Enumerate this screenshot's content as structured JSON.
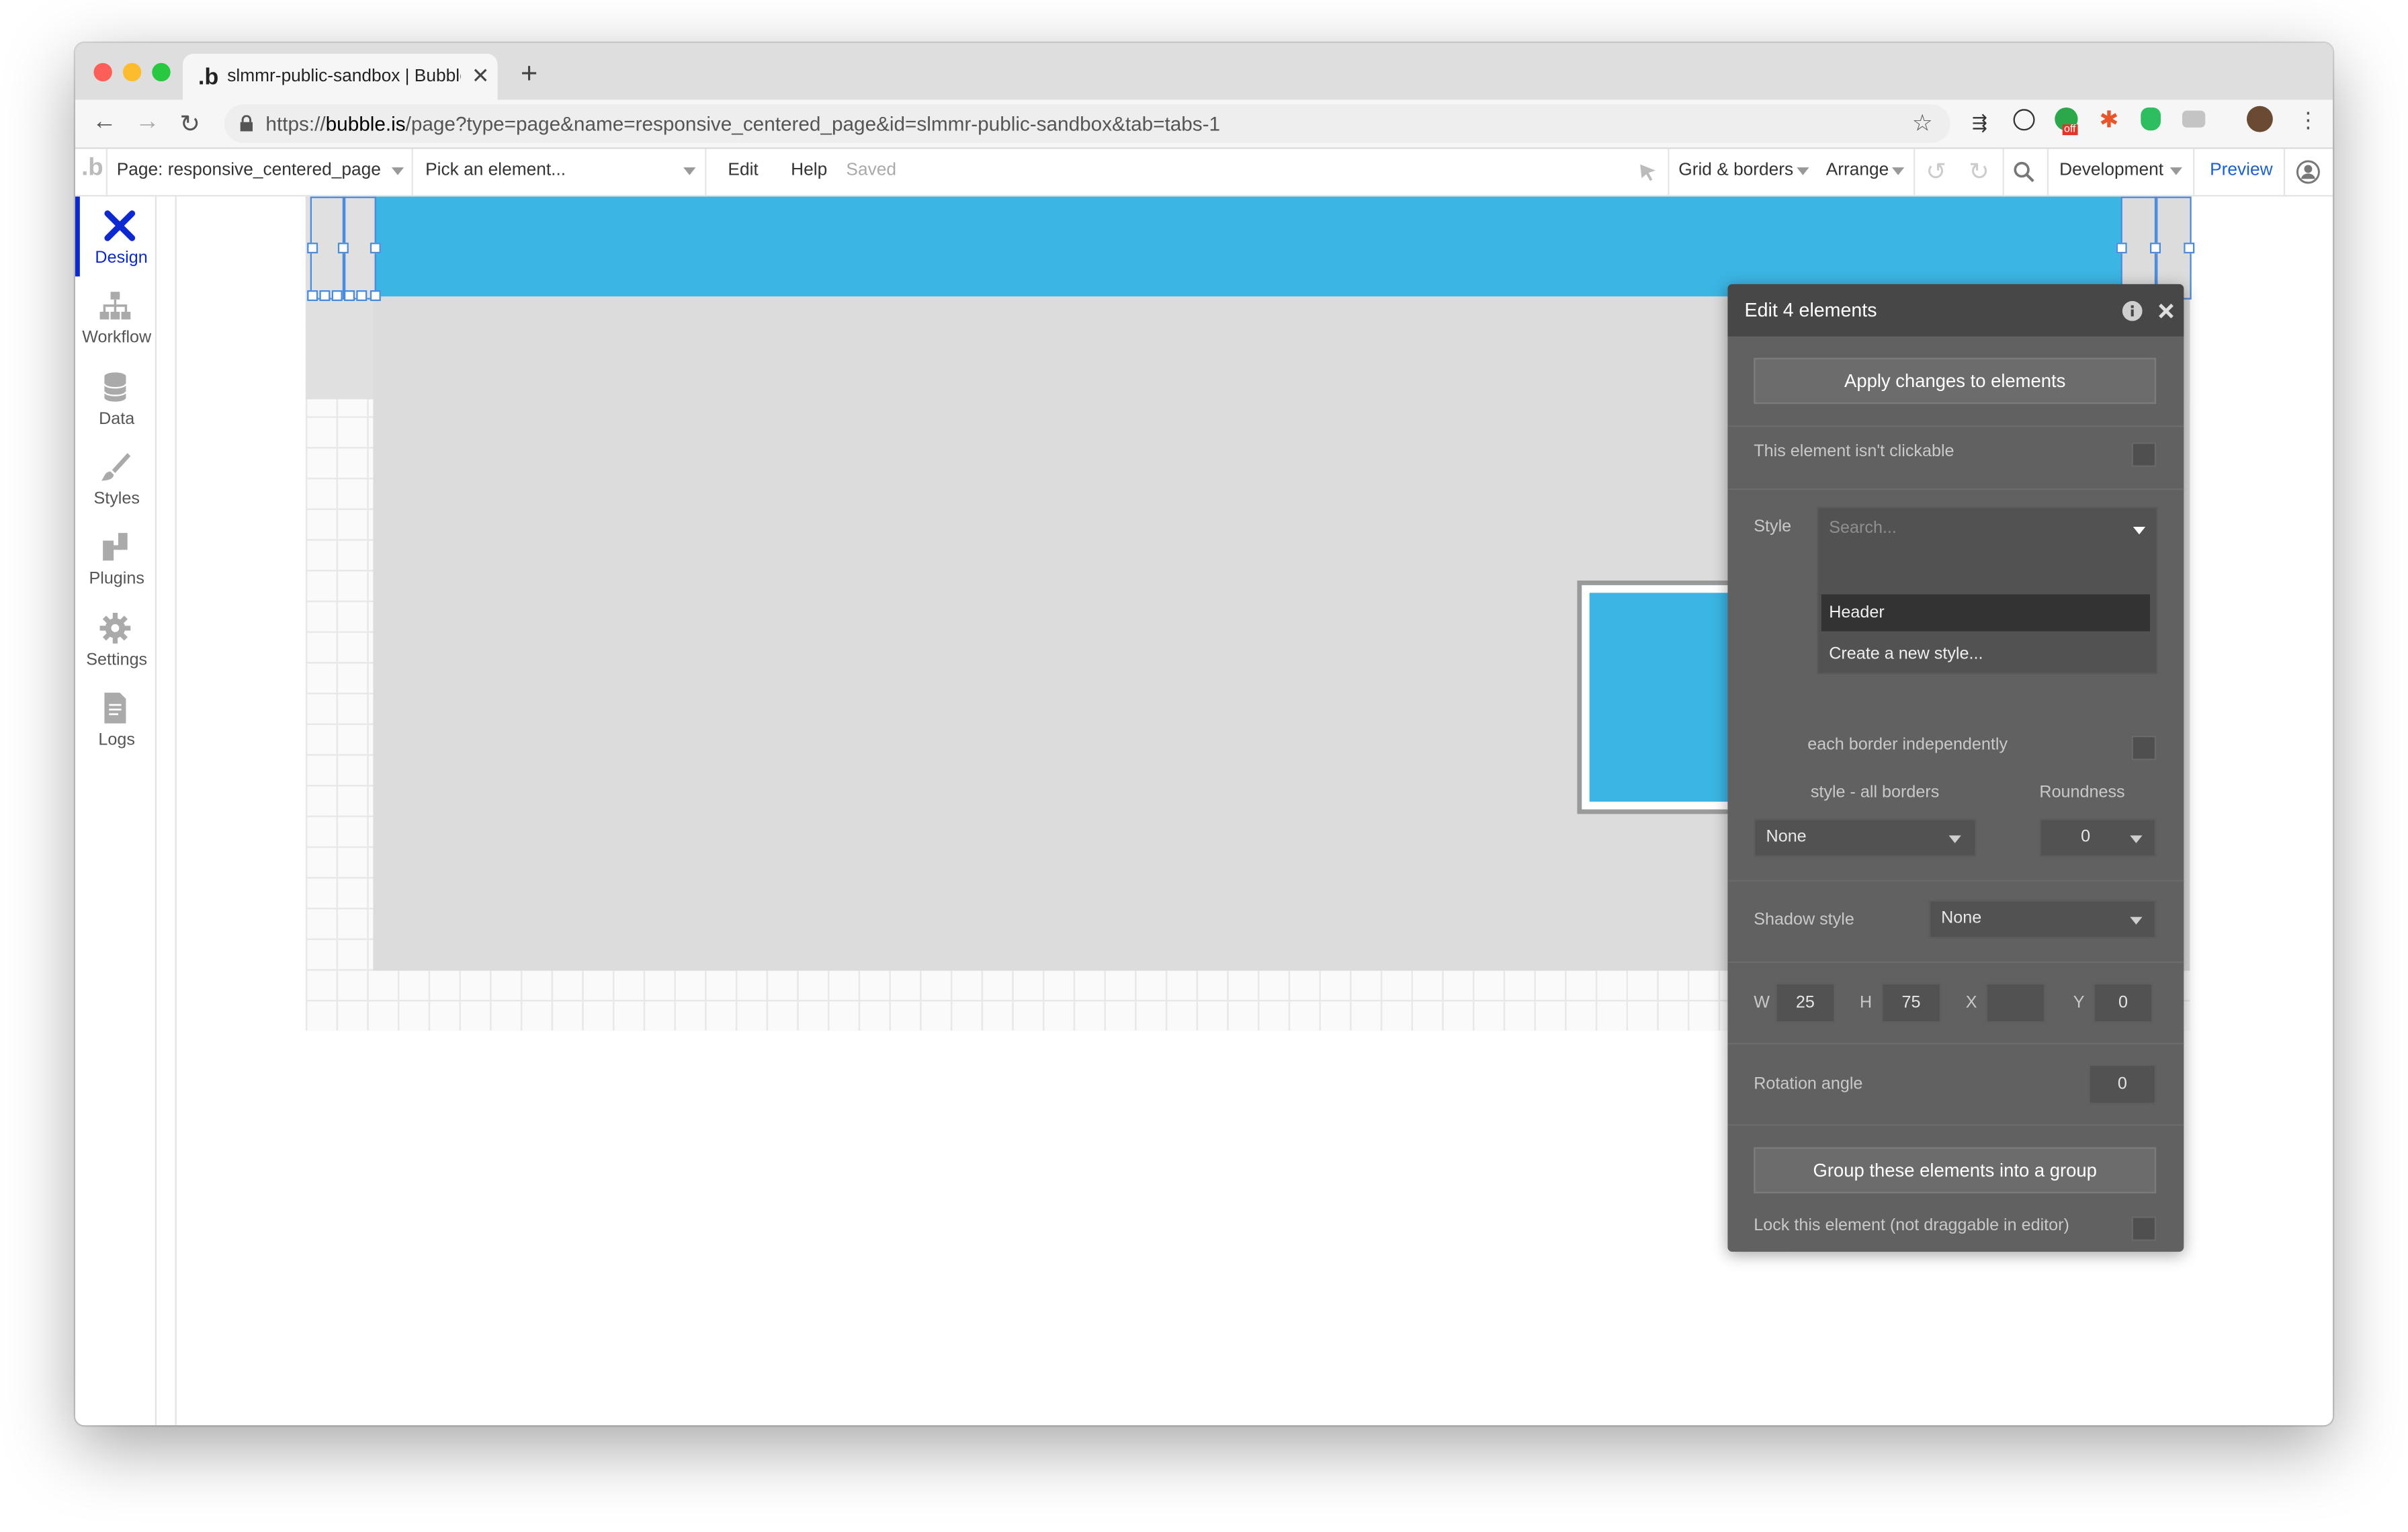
{
  "browser": {
    "tab_title": "slmmr-public-sandbox | Bubble",
    "tab_favicon": ".b",
    "url_scheme": "https://",
    "url_host": "bubble.is",
    "url_path": "/page?type=page&name=responsive_centered_page&id=slmmr-public-sandbox&tab=tabs-1",
    "extension_badge": "off"
  },
  "toolbar": {
    "logo": ".b",
    "page_selector": "Page: responsive_centered_page",
    "element_picker": "Pick an element...",
    "edit": "Edit",
    "help": "Help",
    "save_status": "Saved",
    "grid_borders": "Grid & borders",
    "arrange": "Arrange",
    "version": "Development",
    "preview": "Preview"
  },
  "sidebar": {
    "items": [
      {
        "label": "Design",
        "icon": "design-icon",
        "active": true
      },
      {
        "label": "Workflow",
        "icon": "workflow-icon"
      },
      {
        "label": "Data",
        "icon": "database-icon"
      },
      {
        "label": "Styles",
        "icon": "brush-icon"
      },
      {
        "label": "Plugins",
        "icon": "plug-icon"
      },
      {
        "label": "Settings",
        "icon": "gear-icon"
      },
      {
        "label": "Logs",
        "icon": "document-icon"
      }
    ]
  },
  "colors": {
    "header_blue": "#3bb5e3",
    "panel_bg": "#616161",
    "active_accent": "#0c29d1",
    "preview_link": "#1a5fd6"
  },
  "panel": {
    "title": "Edit 4 elements",
    "apply_button": "Apply changes to elements",
    "not_clickable_label": "This element isn't clickable",
    "style_label": "Style",
    "style_search_placeholder": "Search...",
    "style_options": [
      "Header",
      "Create a new style..."
    ],
    "border_independent_label": "each border independently",
    "border_style_label": "style - all borders",
    "roundness_label": "Roundness",
    "border_style_value": "None",
    "roundness_value": "0",
    "shadow_label": "Shadow style",
    "shadow_value": "None",
    "w_label": "W",
    "w_value": "25",
    "h_label": "H",
    "h_value": "75",
    "x_label": "X",
    "x_value": "",
    "y_label": "Y",
    "y_value": "0",
    "rotation_label": "Rotation angle",
    "rotation_value": "0",
    "group_button": "Group these elements into a group",
    "lock_label": "Lock this element (not draggable in editor)"
  }
}
